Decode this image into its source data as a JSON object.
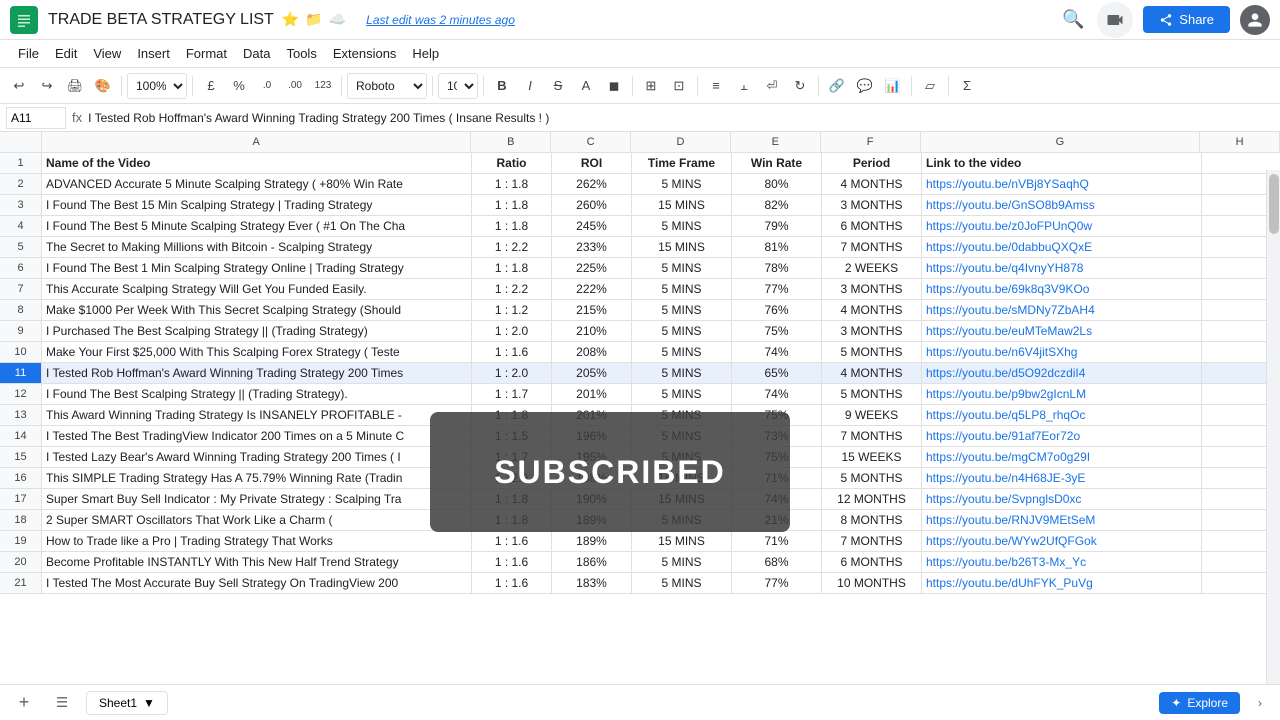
{
  "app": {
    "logo": "S",
    "title": "TRADE BETA STRATEGY LIST",
    "icons": [
      "⭐",
      "📋",
      "☁"
    ],
    "save_status": "Last edit was 2 minutes ago",
    "share_label": "Share",
    "avatar": "👤"
  },
  "menu": {
    "items": [
      "File",
      "Edit",
      "View",
      "Insert",
      "Format",
      "Data",
      "Tools",
      "Extensions",
      "Help"
    ]
  },
  "toolbar": {
    "undo": "↩",
    "redo": "↪",
    "print": "🖨",
    "paint": "🖌",
    "zoom": "100%",
    "currency": "£",
    "percent": "%",
    "decimal0": ".0",
    "decimal00": ".00",
    "more_formats": "123",
    "font": "Roboto",
    "font_size": "10",
    "bold": "B",
    "italic": "I",
    "strikethrough": "S",
    "text_color": "A",
    "fill_color": "◼",
    "borders": "⊞",
    "merge": "⊡",
    "align_h": "≡",
    "align_v": "⫠",
    "text_wrap": "⏎",
    "rotate": "↻",
    "link": "🔗",
    "comment": "💬",
    "chart": "📊",
    "filter": "⏥",
    "functions": "Σ"
  },
  "formula_bar": {
    "cell_ref": "A11",
    "formula": "I Tested Rob Hoffman's Award Winning Trading Strategy 200 Times ( Insane Results ! )"
  },
  "columns": {
    "headers": [
      "",
      "A",
      "B",
      "C",
      "D",
      "E",
      "F",
      "G",
      "H"
    ]
  },
  "header_row": {
    "num": "1",
    "a": "Name of the Video",
    "b": "Ratio",
    "c": "ROI",
    "d": "Time Frame",
    "e": "Win Rate",
    "f": "Period",
    "g": "Link to the video"
  },
  "rows": [
    {
      "num": "2",
      "a": "ADVANCED Accurate 5 Minute Scalping Strategy ( +80% Win Rate",
      "b": "1 : 1.8",
      "c": "262%",
      "d": "5 MINS",
      "e": "80%",
      "f": "4 MONTHS",
      "g": "https://youtu.be/nVBj8YSaqhQ"
    },
    {
      "num": "3",
      "a": "I Found The Best 15 Min Scalping Strategy | Trading Strategy",
      "b": "1 : 1.8",
      "c": "260%",
      "d": "15 MINS",
      "e": "82%",
      "f": "3 MONTHS",
      "g": "https://youtu.be/GnSO8b9Amss"
    },
    {
      "num": "4",
      "a": "I Found The Best 5 Minute Scalping Strategy Ever ( #1 On The Cha",
      "b": "1 : 1.8",
      "c": "245%",
      "d": "5 MINS",
      "e": "79%",
      "f": "6 MONTHS",
      "g": "https://youtu.be/z0JoFPUnQ0w"
    },
    {
      "num": "5",
      "a": "The Secret to Making Millions with Bitcoin - Scalping Strategy",
      "b": "1 : 2.2",
      "c": "233%",
      "d": "15 MINS",
      "e": "81%",
      "f": "7 MONTHS",
      "g": "https://youtu.be/0dabbuQXQxE"
    },
    {
      "num": "6",
      "a": "I Found The Best 1 Min Scalping Strategy Online | Trading Strategy",
      "b": "1 : 1.8",
      "c": "225%",
      "d": "5 MINS",
      "e": "78%",
      "f": "2 WEEKS",
      "g": "https://youtu.be/q4IvnyYH878"
    },
    {
      "num": "7",
      "a": "This Accurate Scalping Strategy Will Get You Funded Easily.",
      "b": "1 : 2.2",
      "c": "222%",
      "d": "5 MINS",
      "e": "77%",
      "f": "3 MONTHS",
      "g": "https://youtu.be/69k8q3V9KOo"
    },
    {
      "num": "8",
      "a": "Make $1000 Per Week With This Secret Scalping Strategy (Should",
      "b": "1 : 1.2",
      "c": "215%",
      "d": "5 MINS",
      "e": "76%",
      "f": "4 MONTHS",
      "g": "https://youtu.be/sMDNy7ZbAH4"
    },
    {
      "num": "9",
      "a": "I Purchased The Best Scalping Strategy || (Trading Strategy)",
      "b": "1 : 2.0",
      "c": "210%",
      "d": "5 MINS",
      "e": "75%",
      "f": "3 MONTHS",
      "g": "https://youtu.be/euMTeMaw2Ls"
    },
    {
      "num": "10",
      "a": "Make Your First $25,000 With This Scalping Forex Strategy ( Teste",
      "b": "1 : 1.6",
      "c": "208%",
      "d": "5 MINS",
      "e": "74%",
      "f": "5 MONTHS",
      "g": "https://youtu.be/n6V4jitSXhg"
    },
    {
      "num": "11",
      "a": "I Tested Rob Hoffman's Award Winning Trading Strategy 200 Times",
      "b": "1 : 2.0",
      "c": "205%",
      "d": "5 MINS",
      "e": "65%",
      "f": "4 MONTHS",
      "g": "https://youtu.be/d5O92dczdiI4",
      "selected": true
    },
    {
      "num": "12",
      "a": "I Found The Best Scalping Strategy || (Trading Strategy).",
      "b": "1 : 1.7",
      "c": "201%",
      "d": "5 MINS",
      "e": "74%",
      "f": "5 MONTHS",
      "g": "https://youtu.be/p9bw2gIcnLM"
    },
    {
      "num": "13",
      "a": "This Award Winning Trading Strategy Is INSANELY PROFITABLE -",
      "b": "1 : 1.8",
      "c": "201%",
      "d": "5 MINS",
      "e": "75%",
      "f": "9 WEEKS",
      "g": "https://youtu.be/q5LP8_rhqOc"
    },
    {
      "num": "14",
      "a": "I Tested The Best TradingView Indicator 200 Times on a 5 Minute C",
      "b": "1 : 1.5",
      "c": "196%",
      "d": "5 MINS",
      "e": "73%",
      "f": "7 MONTHS",
      "g": "https://youtu.be/91af7Eor72o"
    },
    {
      "num": "15",
      "a": "I Tested Lazy Bear's Award Winning Trading Strategy 200 Times ( I",
      "b": "1 : 1.7",
      "c": "195%",
      "d": "5 MINS",
      "e": "75%",
      "f": "15 WEEKS",
      "g": "https://youtu.be/mgCM7o0g29I"
    },
    {
      "num": "16",
      "a": "This SIMPLE Trading Strategy Has A 75.79% Winning Rate (Tradin",
      "b": "1 : 2.0",
      "c": "188%",
      "d": "15 MINS",
      "e": "71%",
      "f": "5 MONTHS",
      "g": "https://youtu.be/n4H68JE-3yE"
    },
    {
      "num": "17",
      "a": "Super Smart Buy Sell Indicator : My Private Strategy : Scalping Tra",
      "b": "1 : 1.8",
      "c": "190%",
      "d": "15 MINS",
      "e": "74%",
      "f": "12 MONTHS",
      "g": "https://youtu.be/SvpnglsD0xc"
    },
    {
      "num": "18",
      "a": "2 Super SMART Oscillators That Work Like a Charm (",
      "b": "1 : 1.8",
      "c": "189%",
      "d": "5 MINS",
      "e": "21%",
      "f": "8 MONTHS",
      "g": "https://youtu.be/RNJV9MEtSeM"
    },
    {
      "num": "19",
      "a": "How to Trade like a Pro | Trading Strategy That Works",
      "b": "1 : 1.6",
      "c": "189%",
      "d": "15 MINS",
      "e": "71%",
      "f": "7 MONTHS",
      "g": "https://youtu.be/WYw2UfQFGok"
    },
    {
      "num": "20",
      "a": "Become Profitable INSTANTLY With This New Half Trend Strategy",
      "b": "1 : 1.6",
      "c": "186%",
      "d": "5 MINS",
      "e": "68%",
      "f": "6 MONTHS",
      "g": "https://youtu.be/b26T3-Mx_Yc"
    },
    {
      "num": "21",
      "a": "I Tested The Most Accurate Buy Sell Strategy On TradingView 200",
      "b": "1 : 1.6",
      "c": "183%",
      "d": "5 MINS",
      "e": "77%",
      "f": "10 MONTHS",
      "g": "https://youtu.be/dUhFYK_PuVg"
    }
  ],
  "subscribed": {
    "text": "SUBSCRIBED"
  },
  "bottom_bar": {
    "add_sheet": "+",
    "sheet_name": "Sheet1",
    "explore_label": "Explore"
  }
}
